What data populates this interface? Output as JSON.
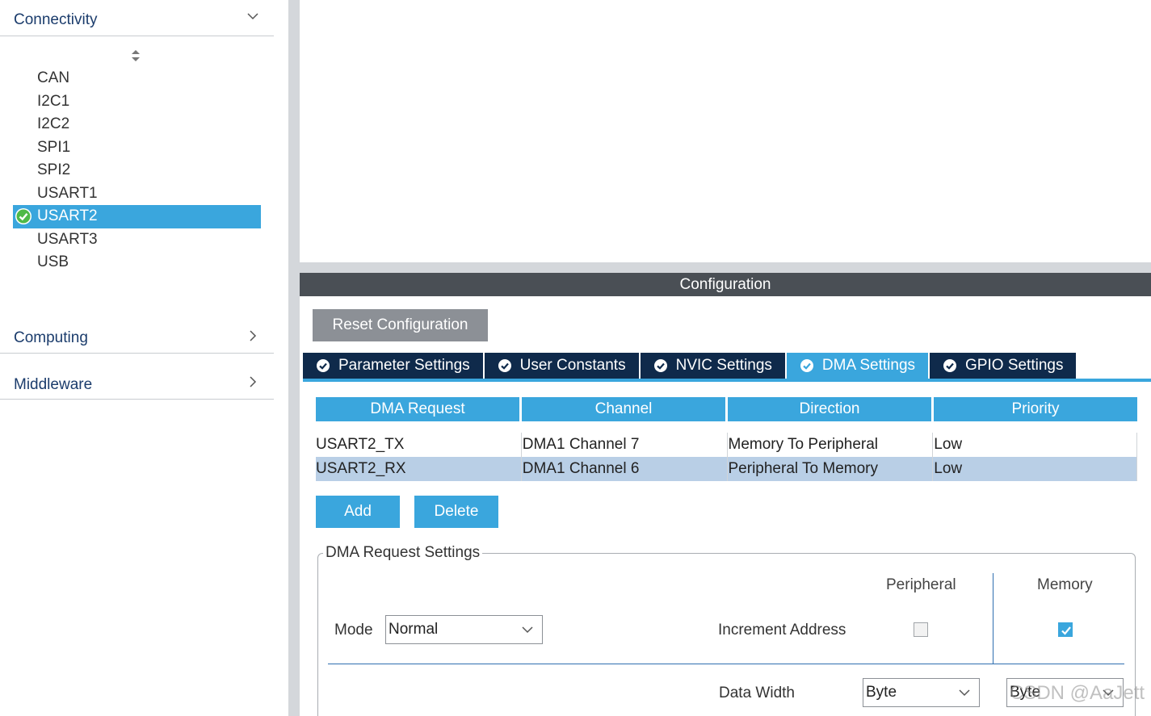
{
  "sidebar": {
    "categories": [
      {
        "label": "Connectivity"
      },
      {
        "label": "Computing"
      },
      {
        "label": "Middleware"
      }
    ],
    "peripherals": [
      {
        "label": "CAN"
      },
      {
        "label": "I2C1"
      },
      {
        "label": "I2C2"
      },
      {
        "label": "SPI1"
      },
      {
        "label": "SPI2"
      },
      {
        "label": "USART1"
      },
      {
        "label": "USART2"
      },
      {
        "label": "USART3"
      },
      {
        "label": "USB"
      }
    ],
    "selected_peripheral": "USART2"
  },
  "config": {
    "title": "Configuration",
    "reset_label": "Reset Configuration",
    "tabs": [
      {
        "label": "Parameter Settings"
      },
      {
        "label": "User Constants"
      },
      {
        "label": "NVIC Settings"
      },
      {
        "label": "DMA Settings"
      },
      {
        "label": "GPIO Settings"
      }
    ],
    "active_tab": "DMA Settings"
  },
  "dma_table": {
    "headers": [
      "DMA Request",
      "Channel",
      "Direction",
      "Priority"
    ],
    "rows": [
      [
        "USART2_TX",
        "DMA1 Channel 7",
        "Memory To Peripheral",
        "Low"
      ],
      [
        "USART2_RX",
        "DMA1 Channel 6",
        "Peripheral To Memory",
        "Low"
      ]
    ],
    "selected_row": 1,
    "add_label": "Add",
    "delete_label": "Delete"
  },
  "request_settings": {
    "title": "DMA Request Settings",
    "peripheral_col": "Peripheral",
    "memory_col": "Memory",
    "mode_label": "Mode",
    "mode_value": "Normal",
    "increment_label": "Increment Address",
    "increment_peripheral": false,
    "increment_memory": true,
    "data_width_label": "Data Width",
    "data_width_peripheral": "Byte",
    "data_width_memory": "Byte"
  },
  "watermark": "CSDN @AaJett",
  "colors": {
    "accent": "#3aa6dd",
    "tab_dark": "#0f2a4b",
    "config_bar": "#4a4f55",
    "selected_row": "#b9cfe6",
    "category_text": "#1b3c6c"
  }
}
